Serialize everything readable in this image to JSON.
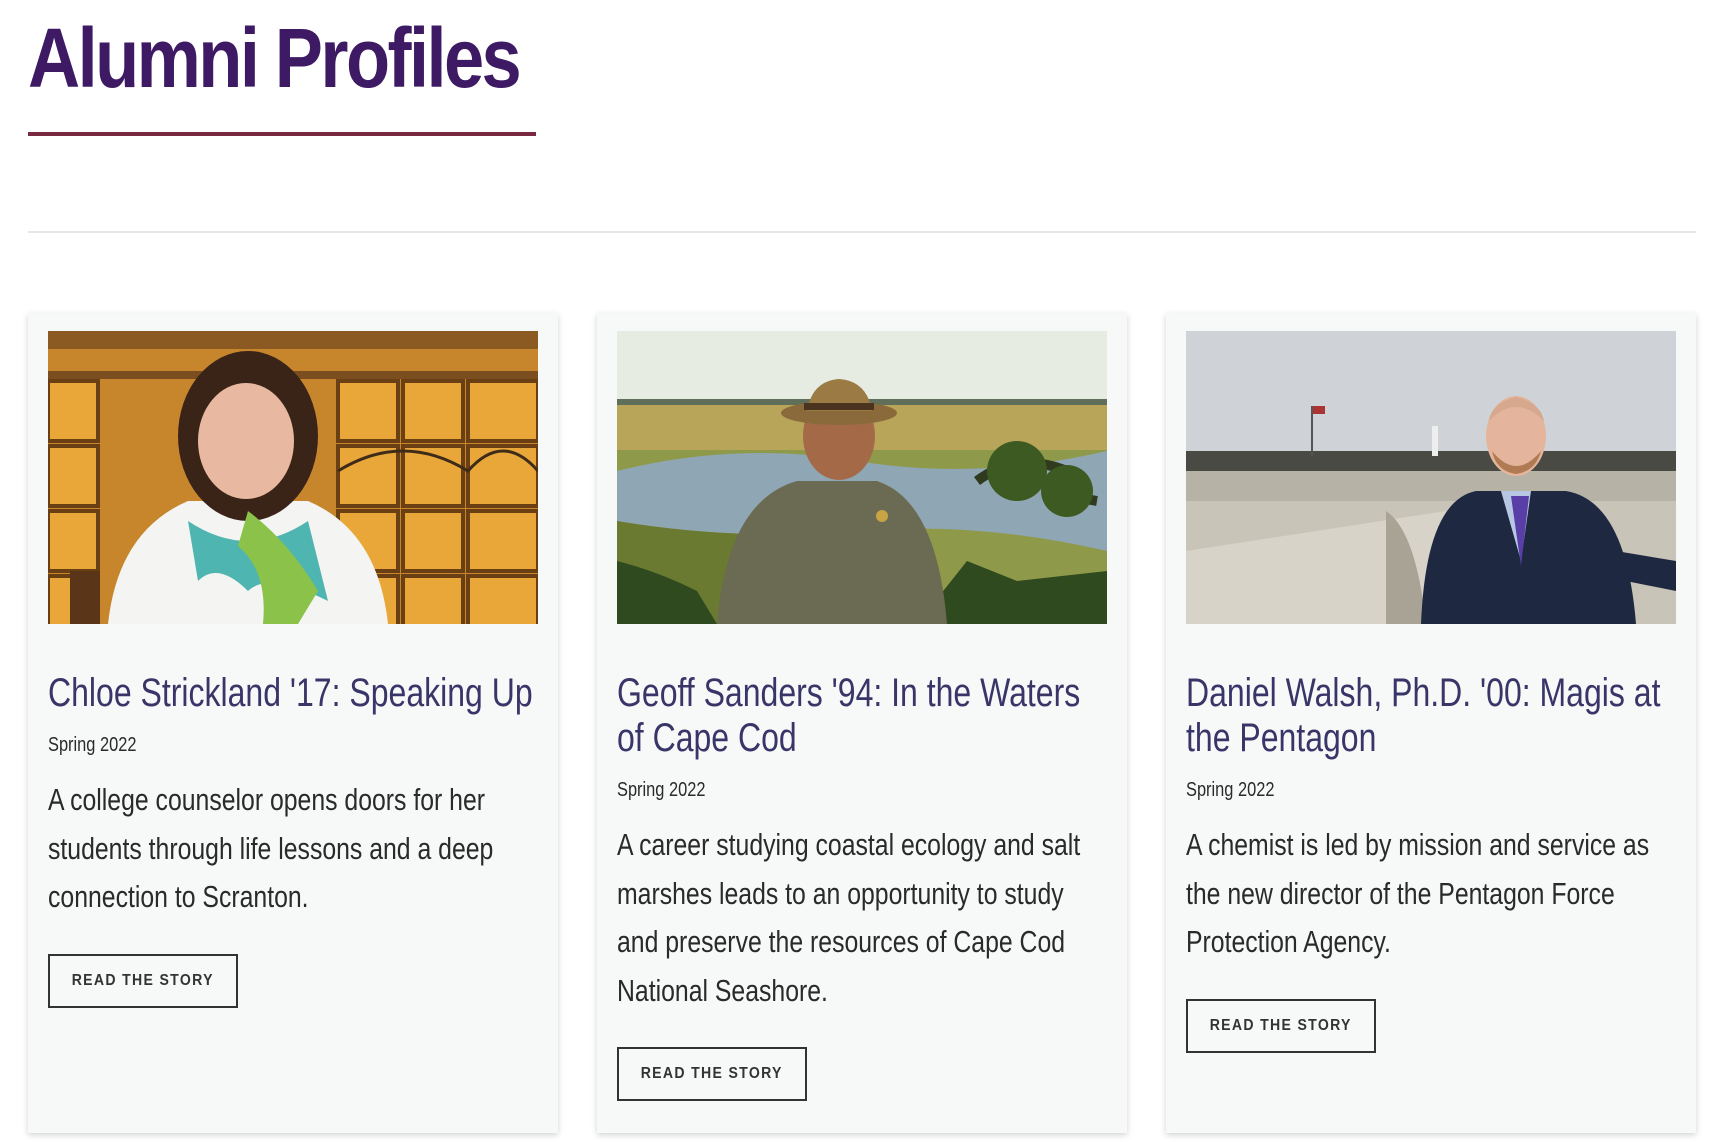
{
  "page": {
    "title": "Alumni Profiles"
  },
  "colors": {
    "title": "#3d1a63",
    "underline": "#7a2a40",
    "card_title": "#3a3568",
    "card_bg": "#f7f8f8"
  },
  "profiles": [
    {
      "image_alt": "Portrait of Chloe Strickland smiling in front of stained glass windows",
      "title": "Chloe Strickland '17: Speaking Up",
      "date": "Spring 2022",
      "description": "A college counselor opens doors for her students through life lessons and a deep connection to Scranton.",
      "button_label": "READ THE STORY"
    },
    {
      "image_alt": "Geoff Sanders in park ranger uniform by a salt marsh",
      "title": "Geoff Sanders '94: In the Waters of Cape Cod",
      "date": "Spring 2022",
      "description": "A career studying coastal ecology and salt marshes leads to an opportunity to study and preserve the resources of Cape Cod National Seashore.",
      "button_label": "READ THE STORY"
    },
    {
      "image_alt": "Daniel Walsh in a suit standing at a memorial overlook",
      "title": "Daniel Walsh, Ph.D. '00: Magis at the Pentagon",
      "date": "Spring 2022",
      "description": "A chemist is led by mission and service as the new director of the Pentagon Force Protection Agency.",
      "button_label": "READ THE STORY"
    }
  ]
}
